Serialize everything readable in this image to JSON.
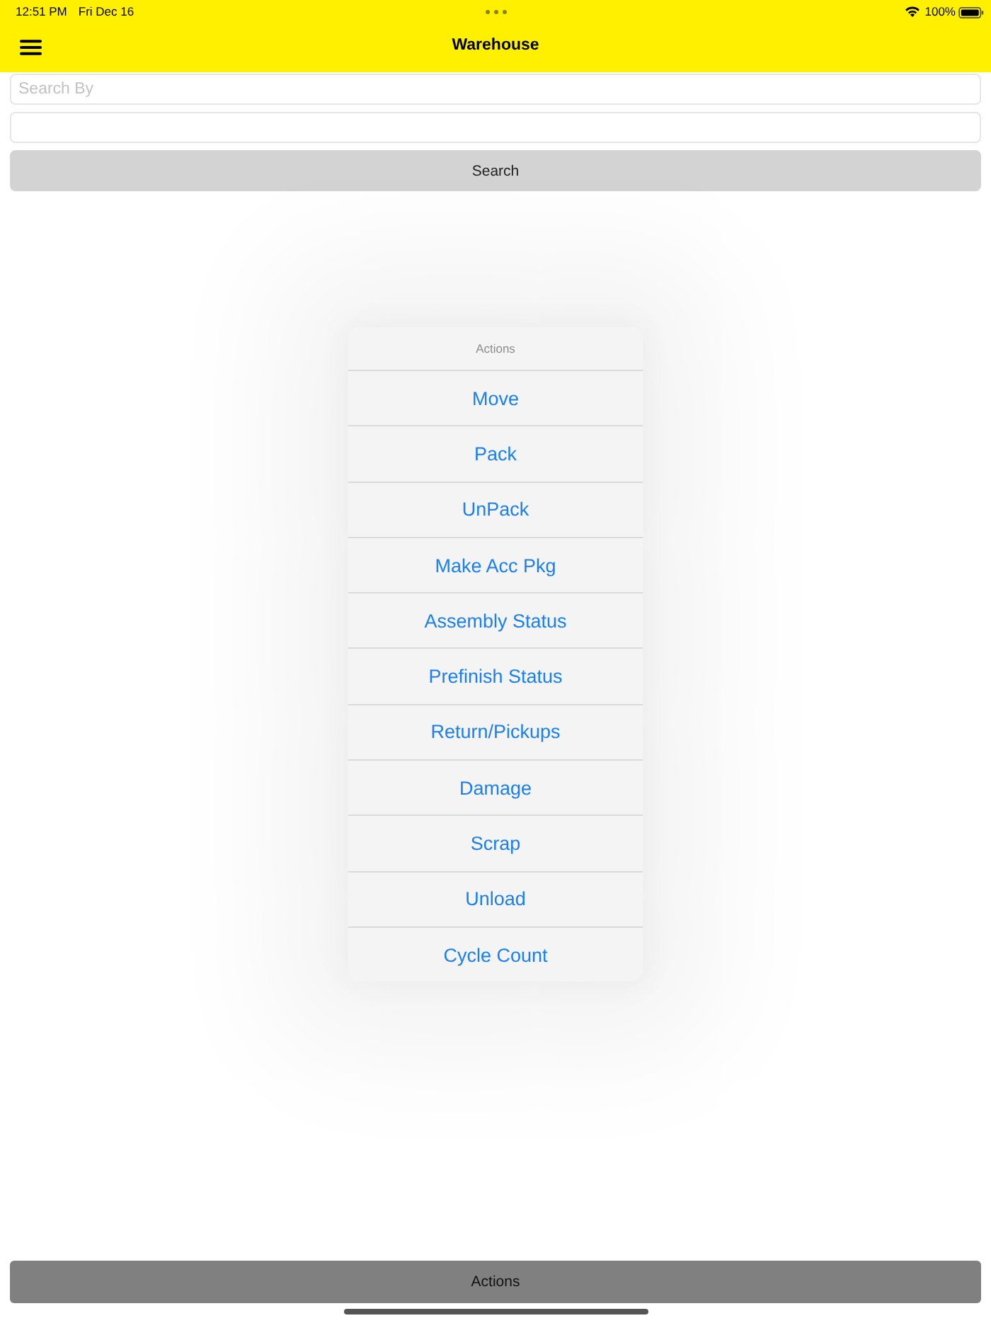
{
  "status_bar": {
    "time": "12:51 PM",
    "date": "Fri Dec 16",
    "battery": "100%"
  },
  "nav_bar": {
    "title": "Warehouse"
  },
  "search_form": {
    "search_by_placeholder": "Search By",
    "button": "Search"
  },
  "action_sheet": {
    "title": "Actions",
    "items": [
      "Move",
      "Pack",
      "UnPack",
      "Make Acc Pkg",
      "Assembly Status",
      "Prefinish Status",
      "Return/Pickups",
      "Damage",
      "Scrap",
      "Unload",
      "Cycle Count"
    ]
  },
  "bottom_button": "Actions"
}
